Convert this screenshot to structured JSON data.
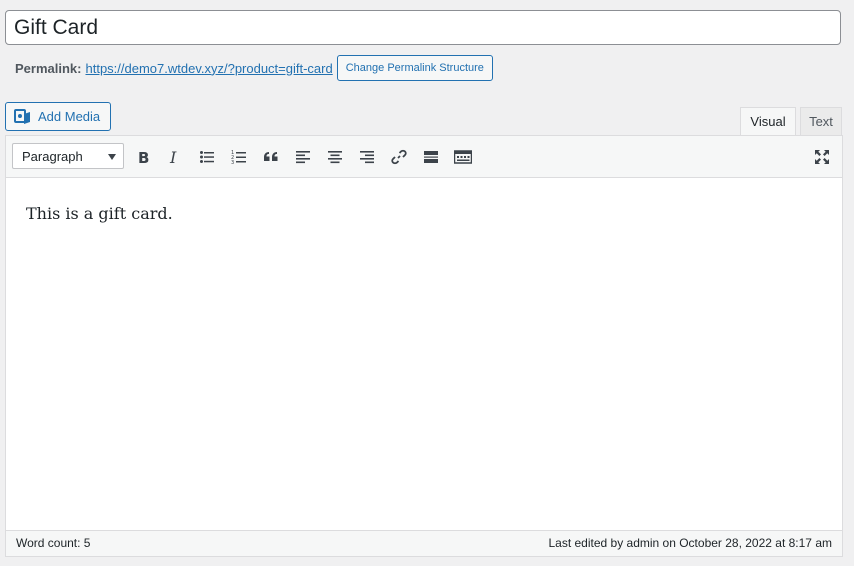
{
  "post": {
    "title": "Gift Card"
  },
  "permalink": {
    "label": "Permalink:",
    "url": "https://demo7.wtdev.xyz/?product=gift-card",
    "change_button": "Change Permalink Structure"
  },
  "media": {
    "add_label": "Add Media"
  },
  "tabs": {
    "visual": "Visual",
    "text": "Text"
  },
  "toolbar": {
    "format": "Paragraph",
    "buttons": [
      "bold-icon",
      "italic-icon",
      "bulleted-list-icon",
      "numbered-list-icon",
      "blockquote-icon",
      "align-left-icon",
      "align-center-icon",
      "align-right-icon",
      "link-icon",
      "read-more-icon",
      "toolbar-toggle-icon",
      "fullscreen-icon"
    ]
  },
  "editor": {
    "content": "This is a gift card."
  },
  "status": {
    "word_count": "Word count: 5",
    "last_edited": "Last edited by admin on October 28, 2022 at 8:17 am"
  },
  "colors": {
    "accent": "#2271b1",
    "background": "#f0f0f1"
  }
}
